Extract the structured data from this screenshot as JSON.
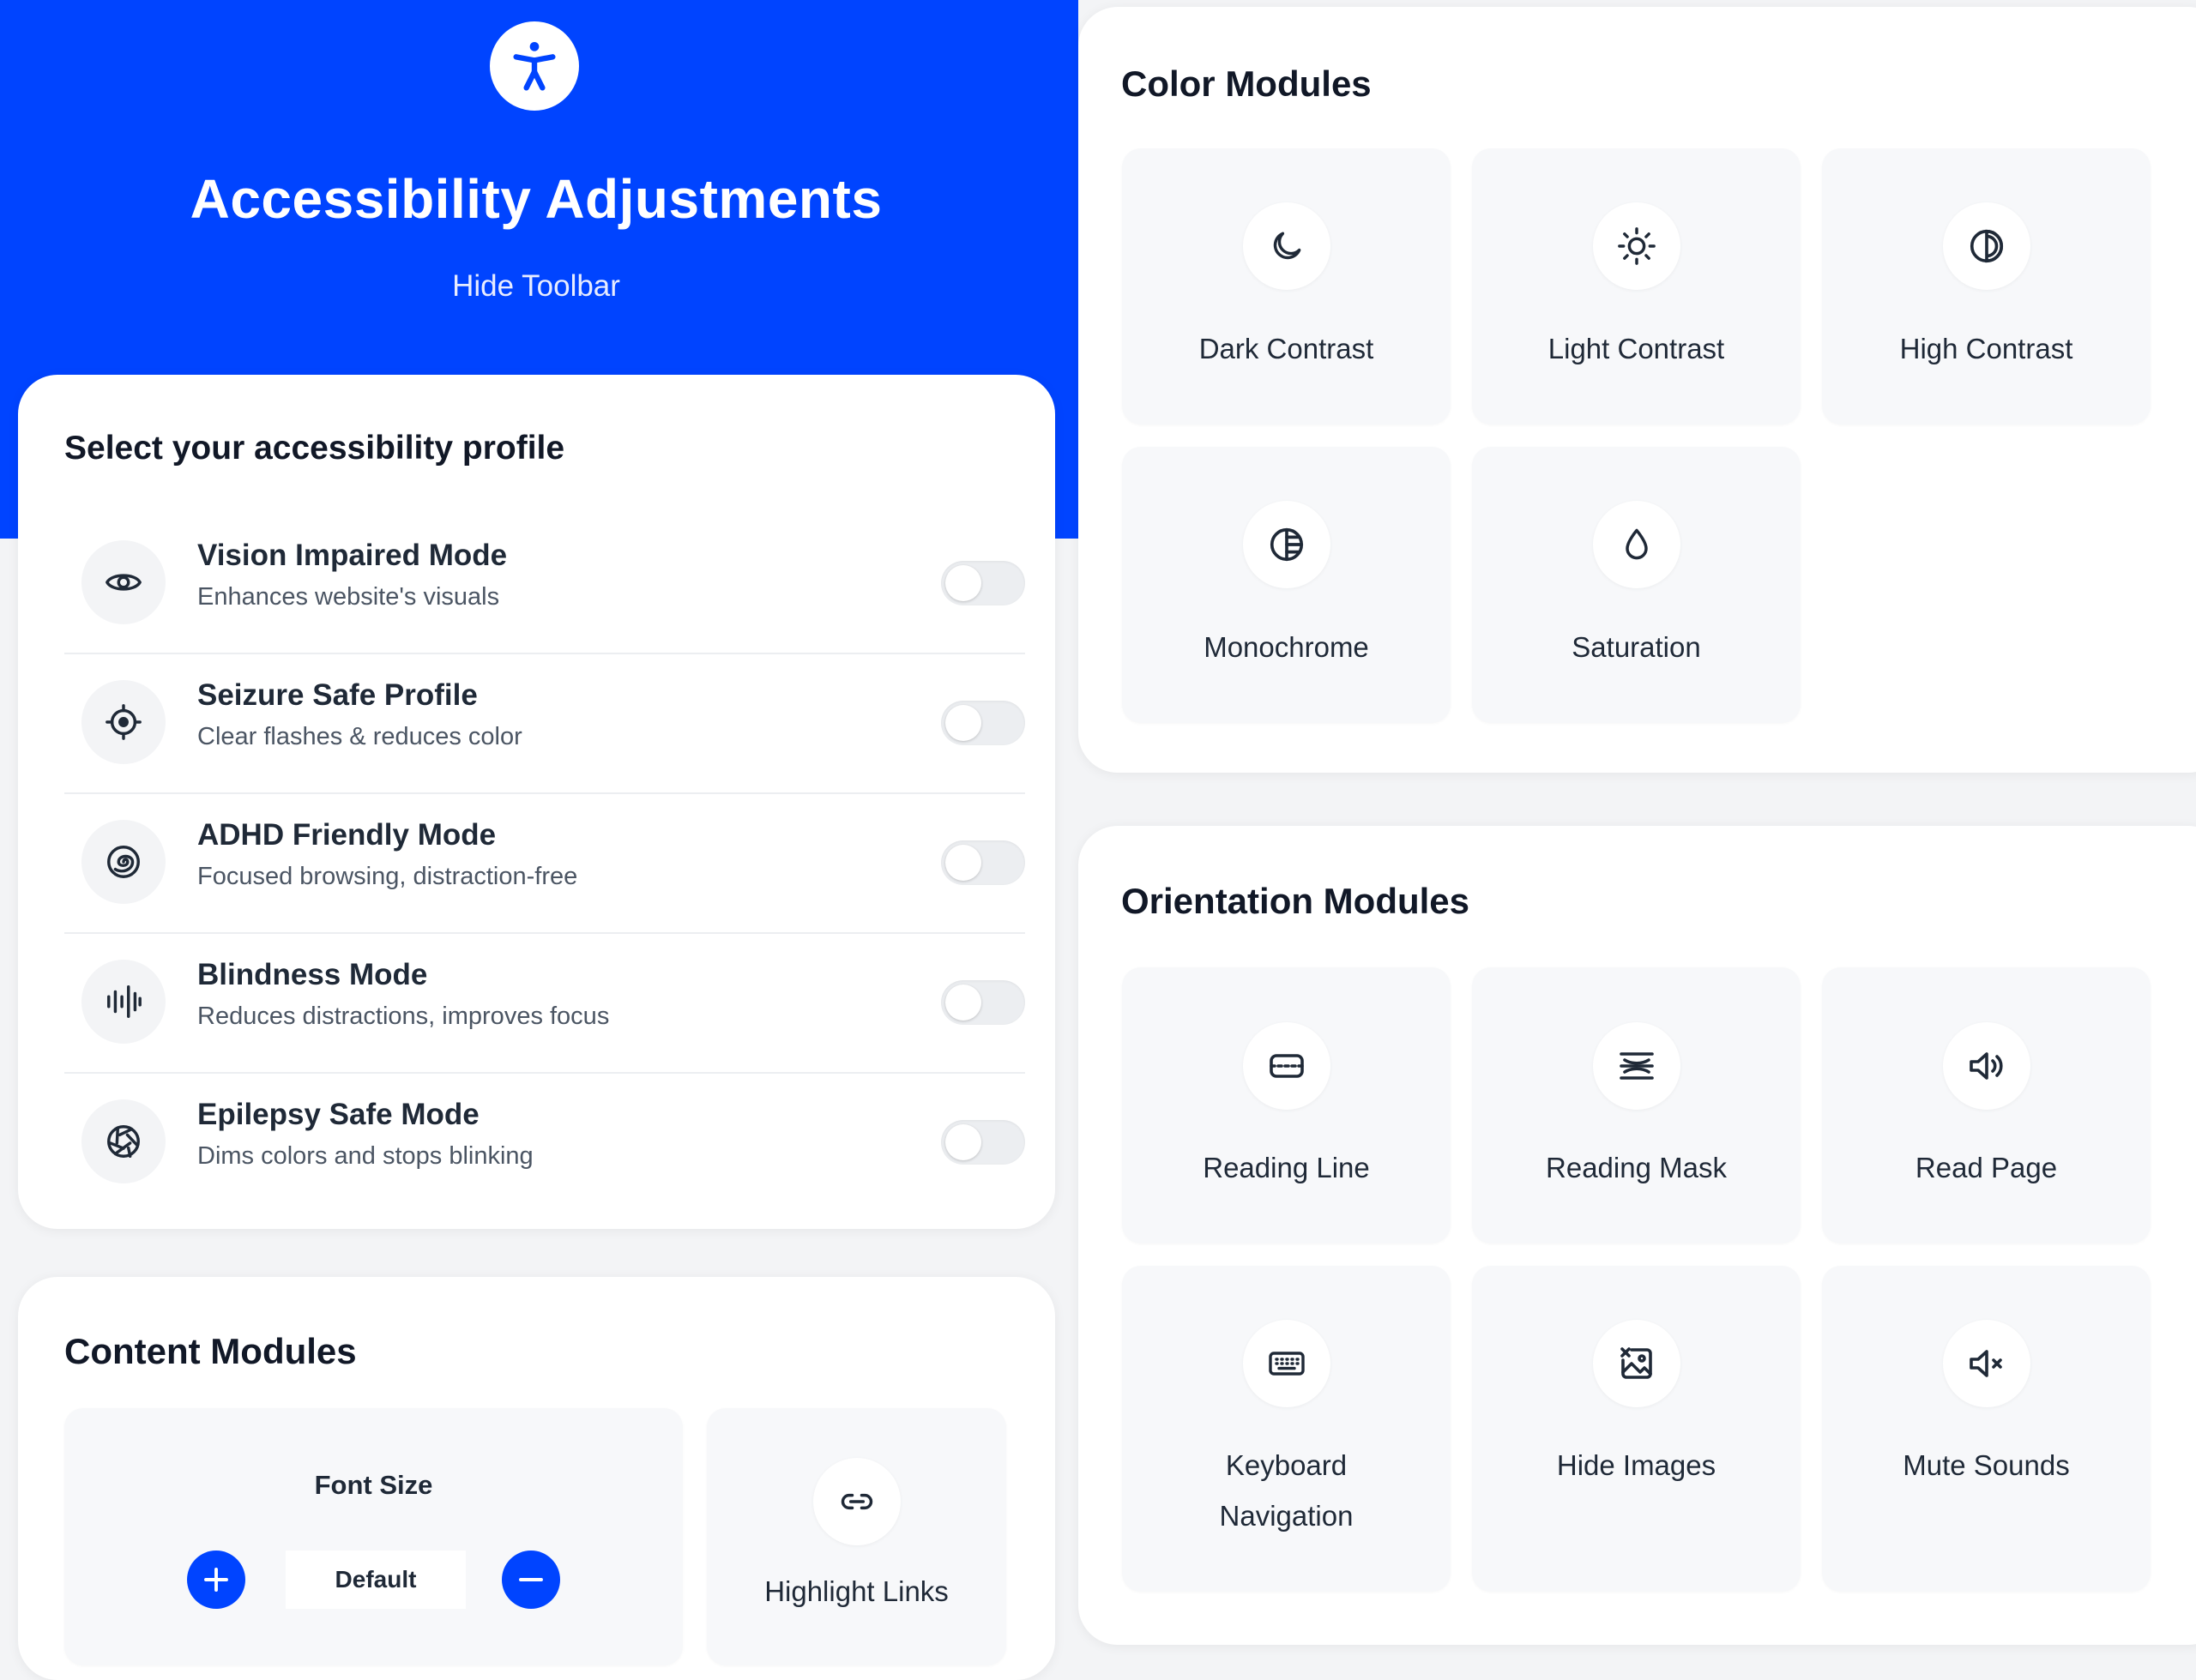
{
  "header": {
    "title": "Accessibility Adjustments",
    "hide_toolbar": "Hide Toolbar",
    "logo_icon": "accessibility-person-icon",
    "background_color": "#0044ff"
  },
  "profiles": {
    "title": "Select your accessibility profile",
    "items": [
      {
        "label": "Vision Impaired Mode",
        "description": "Enhances website's visuals",
        "icon": "eye-icon",
        "enabled": false
      },
      {
        "label": "Seizure Safe Profile",
        "description": "Clear flashes & reduces color",
        "icon": "target-icon",
        "enabled": false
      },
      {
        "label": "ADHD Friendly Mode",
        "description": "Focused browsing, distraction-free",
        "icon": "spiral-icon",
        "enabled": false
      },
      {
        "label": "Blindness Mode",
        "description": "Reduces distractions, improves focus",
        "icon": "audio-bars-icon",
        "enabled": false
      },
      {
        "label": "Epilepsy Safe Mode",
        "description": "Dims colors and stops blinking",
        "icon": "aperture-icon",
        "enabled": false
      }
    ]
  },
  "content_modules": {
    "title": "Content Modules",
    "font_size": {
      "label": "Font Size",
      "value": "Default"
    },
    "highlight_links": "Highlight Links"
  },
  "color_modules": {
    "title": "Color Modules",
    "items": [
      {
        "label": "Dark Contrast",
        "icon": "moon-icon"
      },
      {
        "label": "Light Contrast",
        "icon": "sun-icon"
      },
      {
        "label": "High Contrast",
        "icon": "contrast-icon"
      },
      {
        "label": "Monochrome",
        "icon": "monochrome-icon"
      },
      {
        "label": "Saturation",
        "icon": "droplet-icon"
      }
    ]
  },
  "orientation_modules": {
    "title": "Orientation Modules",
    "items": [
      {
        "label": "Reading Line",
        "icon": "reading-line-icon"
      },
      {
        "label": "Reading Mask",
        "icon": "reading-mask-icon"
      },
      {
        "label": "Read Page",
        "icon": "speaker-icon"
      },
      {
        "label_line1": "Keyboard",
        "label_line2": "Navigation",
        "icon": "keyboard-icon"
      },
      {
        "label": "Hide Images",
        "icon": "image-off-icon"
      },
      {
        "label": "Mute Sounds",
        "icon": "speaker-muted-icon"
      }
    ]
  }
}
